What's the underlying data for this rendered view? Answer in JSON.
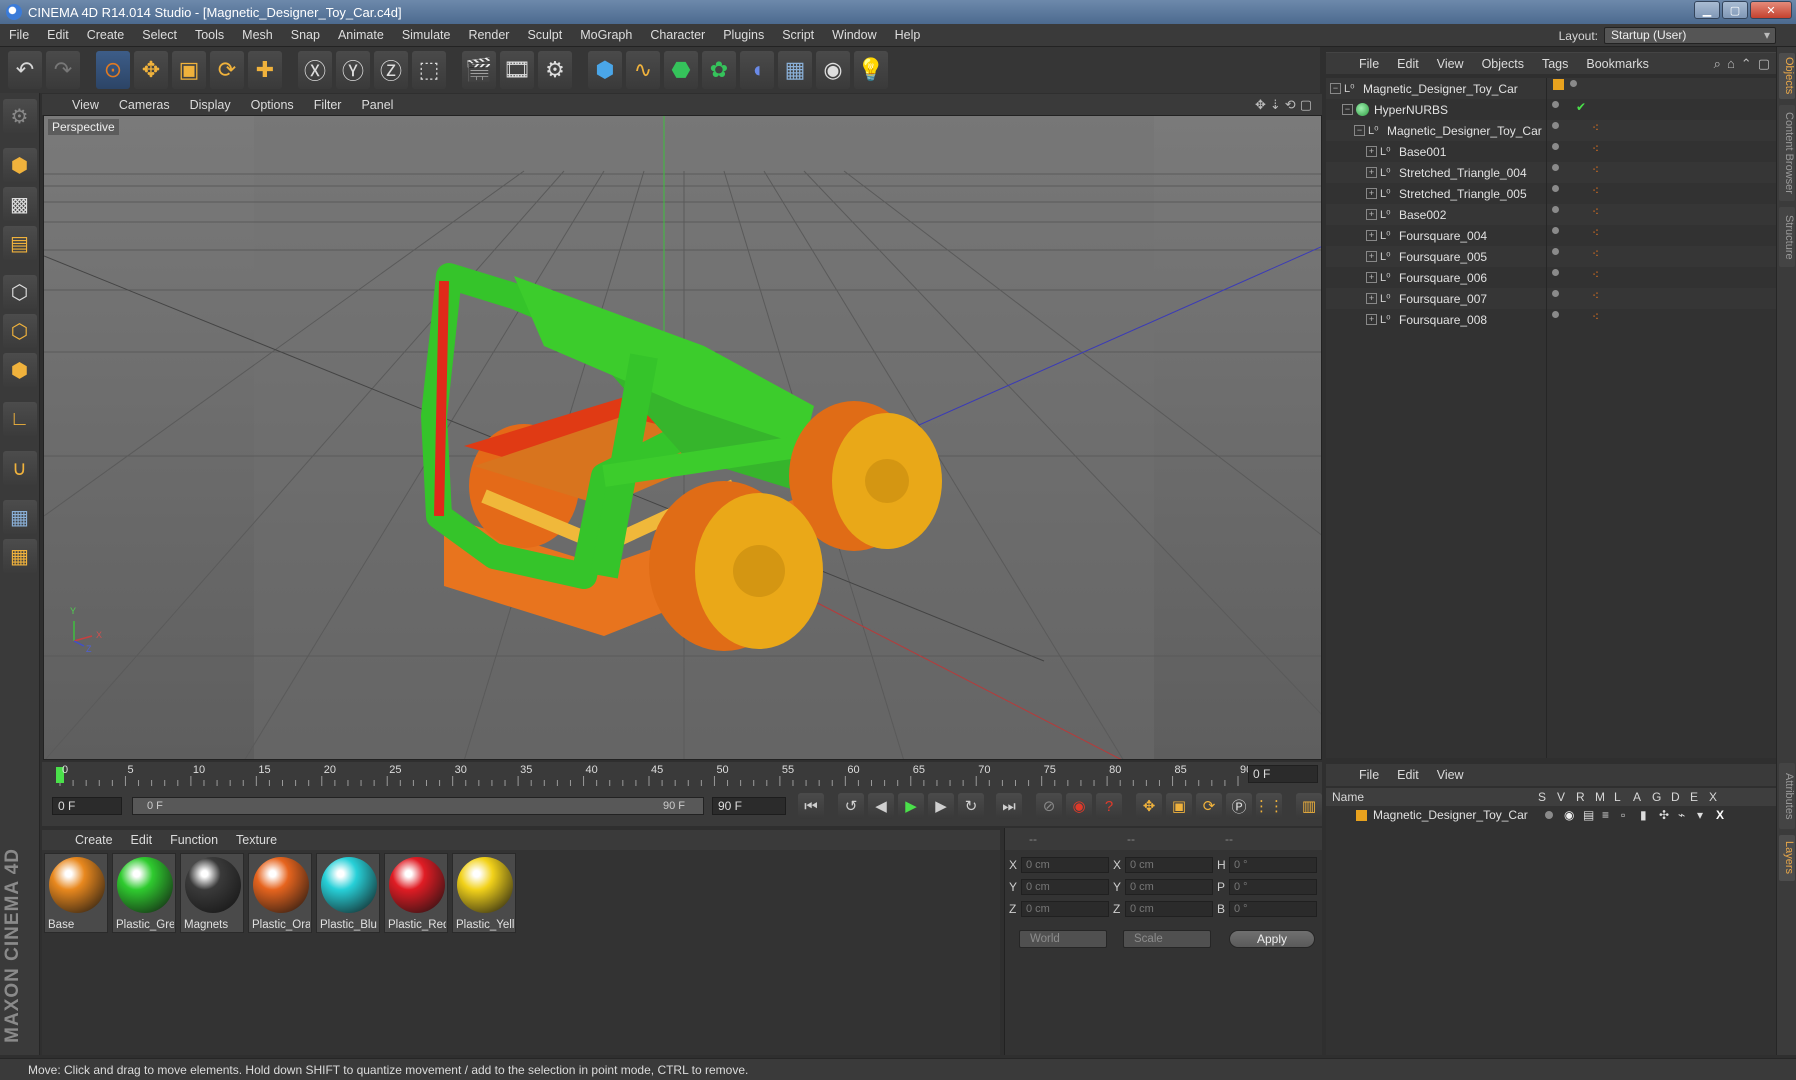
{
  "window": {
    "title": "CINEMA 4D R14.014 Studio - [Magnetic_Designer_Toy_Car.c4d]"
  },
  "menubar": {
    "items": [
      "File",
      "Edit",
      "Create",
      "Select",
      "Tools",
      "Mesh",
      "Snap",
      "Animate",
      "Simulate",
      "Render",
      "Sculpt",
      "MoGraph",
      "Character",
      "Plugins",
      "Script",
      "Window",
      "Help"
    ],
    "layout_label": "Layout:",
    "layout_value": "Startup (User)"
  },
  "toolbar": {
    "tools": [
      "undo-icon",
      "redo-icon",
      "live-selection-icon",
      "move-icon",
      "scale-icon",
      "rotate-icon",
      "recent-tool-icon",
      "x-axis-lock-icon",
      "y-axis-lock-icon",
      "z-axis-lock-icon",
      "coordinate-system-icon",
      "render-view-icon",
      "render-picture-viewer-icon",
      "render-settings-icon",
      "cube-icon",
      "spline-pen-icon",
      "nurbs-icon",
      "array-icon",
      "deformer-icon",
      "floor-icon",
      "camera-icon",
      "light-icon"
    ]
  },
  "viewport": {
    "menu": [
      "View",
      "Cameras",
      "Display",
      "Options",
      "Filter",
      "Panel"
    ],
    "label": "Perspective",
    "axis_labels": {
      "x": "X",
      "y": "Y",
      "z": "Z"
    }
  },
  "timeline": {
    "ticks": [
      "0",
      "5",
      "10",
      "15",
      "20",
      "25",
      "30",
      "35",
      "40",
      "45",
      "50",
      "55",
      "60",
      "65",
      "70",
      "75",
      "80",
      "85",
      "90"
    ],
    "current_frame_display": "0 F",
    "start_field": "0 F",
    "range_start": "0 F",
    "range_end": "90 F",
    "end_field": "90 F"
  },
  "materials": {
    "menu": [
      "Create",
      "Edit",
      "Function",
      "Texture"
    ],
    "items": [
      {
        "name": "Base",
        "color": "#e8881e"
      },
      {
        "name": "Plastic_Gre",
        "color": "#2fcb2f"
      },
      {
        "name": "Magnets",
        "color": "#3a3a3a"
      },
      {
        "name": "Plastic_Ora",
        "color": "#e6641e"
      },
      {
        "name": "Plastic_Blu",
        "color": "#27d0d8"
      },
      {
        "name": "Plastic_Red",
        "color": "#e01c24"
      },
      {
        "name": "Plastic_Yell",
        "color": "#f2d21a"
      }
    ]
  },
  "coordinates": {
    "header": [
      "--",
      "--",
      "--"
    ],
    "rows": [
      {
        "axis": "X",
        "pos": "0 cm",
        "size": "0 cm",
        "rot_label": "H",
        "rot": "0 °"
      },
      {
        "axis": "Y",
        "pos": "0 cm",
        "size": "0 cm",
        "rot_label": "P",
        "rot": "0 °"
      },
      {
        "axis": "Z",
        "pos": "0 cm",
        "size": "0 cm",
        "rot_label": "B",
        "rot": "0 °"
      }
    ],
    "mode": "World",
    "scale_mode": "Scale",
    "apply_label": "Apply"
  },
  "object_manager": {
    "menu": [
      "File",
      "Edit",
      "View",
      "Objects",
      "Tags",
      "Bookmarks"
    ],
    "objects": [
      "Magnetic_Designer_Toy_Car",
      "HyperNURBS",
      "Magnetic_Designer_Toy_Car",
      "Base001",
      "Stretched_Triangle_004",
      "Stretched_Triangle_005",
      "Base002",
      "Foursquare_004",
      "Foursquare_005",
      "Foursquare_006",
      "Foursquare_007",
      "Foursquare_008"
    ]
  },
  "layer_manager": {
    "menu": [
      "File",
      "Edit",
      "View"
    ],
    "columns": [
      "Name",
      "S",
      "V",
      "R",
      "M",
      "L",
      "A",
      "G",
      "D",
      "E",
      "X"
    ],
    "rows": [
      "Magnetic_Designer_Toy_Car"
    ]
  },
  "side_tabs": [
    "Objects",
    "Content Browser",
    "Structure",
    "Attributes",
    "Layers"
  ],
  "branding": "MAXON CINEMA 4D",
  "status": "Move: Click and drag to move elements. Hold down SHIFT to quantize movement / add to the selection in point mode, CTRL to remove."
}
